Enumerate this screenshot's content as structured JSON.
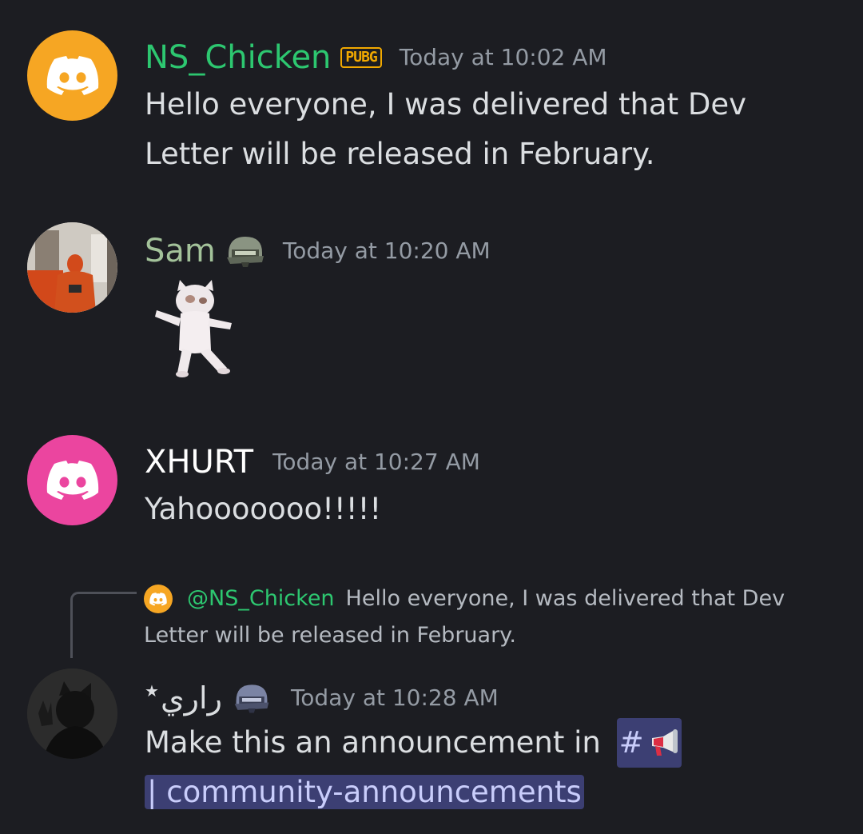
{
  "messages": [
    {
      "username": "NS_Chicken",
      "badge": "PUBG",
      "timestamp": "Today at 10:02 AM",
      "content_line1": "Hello everyone, I was delivered that Dev",
      "content_line2": "Letter will be released in February.",
      "avatar_color": "#f6a623",
      "name_color": "#2dc770"
    },
    {
      "username": "Sam",
      "badge_icon": "helmet-icon",
      "timestamp": "Today at 10:20 AM",
      "sticker": "dancing-cat-sticker",
      "name_color": "#a3c29a"
    },
    {
      "username": "XHURT",
      "timestamp": "Today at 10:27 AM",
      "content": "Yahooooooo!!!!!",
      "avatar_color": "#eb459f",
      "name_color": "#ffffff"
    },
    {
      "reply": {
        "mention": "@NS_Chicken",
        "text_line1": "Hello everyone, I was delivered that Dev",
        "text_line2": "Letter will be released in February."
      },
      "username": "راري",
      "username_suffix": "★",
      "badge_icon": "helmet-icon",
      "timestamp": "Today at 10:28 AM",
      "content_prefix": "Make this an announcement in",
      "channel_hash": "#",
      "channel_icon": "megaphone-icon",
      "channel_name": "| community-announcements",
      "name_color": "#dbdee1"
    }
  ],
  "colors": {
    "background": "#1c1d22",
    "timestamp": "#949ba4",
    "mention": "#2dc770",
    "channel_mention_bg": "#3c3f73",
    "channel_mention_fg": "#c9cdfb"
  }
}
